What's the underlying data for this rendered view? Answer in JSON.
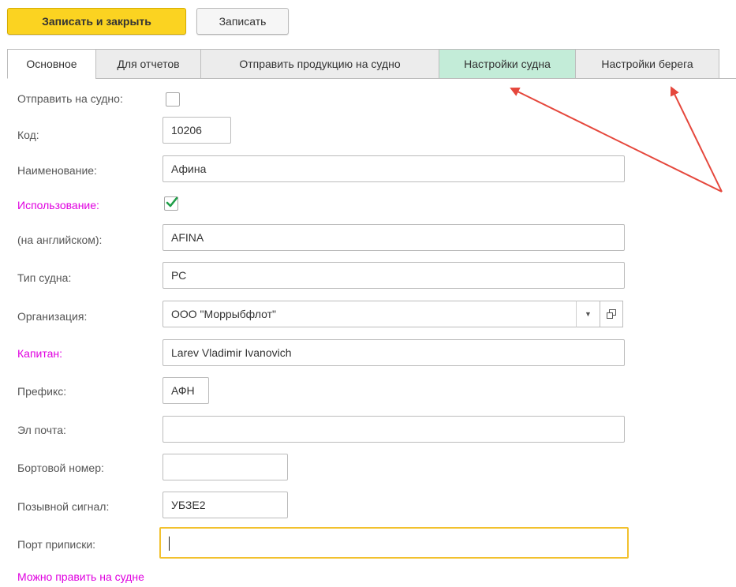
{
  "toolbar": {
    "save_close_label": "Записать и закрыть",
    "save_label": "Записать"
  },
  "tabs": [
    {
      "label": "Основное",
      "active": true
    },
    {
      "label": "Для отчетов"
    },
    {
      "label": "Отправить продукцию на судно"
    },
    {
      "label": "Настройки судна",
      "highlighted": true
    },
    {
      "label": "Настройки берега"
    }
  ],
  "form": {
    "send_to_ship": {
      "label": "Отправить на судно:",
      "checked": false
    },
    "code": {
      "label": "Код:",
      "value": "10206"
    },
    "name": {
      "label": "Наименование:",
      "value": "Афина"
    },
    "usage": {
      "label": "Использование:",
      "checked": true
    },
    "english": {
      "label": "(на английском):",
      "value": "AFINA"
    },
    "ship_type": {
      "label": "Тип судна:",
      "value": "РС"
    },
    "organization": {
      "label": "Организация:",
      "value": "ООО \"Моррыбфлот\""
    },
    "captain": {
      "label": "Капитан:",
      "value": "Larev Vladimir Ivanovich"
    },
    "prefix": {
      "label": "Префикс:",
      "value": "АФН"
    },
    "email": {
      "label": "Эл почта:",
      "value": ""
    },
    "board_number": {
      "label": "Бортовой номер:",
      "value": ""
    },
    "call_sign": {
      "label": "Позывной сигнал:",
      "value": "УБЗЕ2"
    },
    "home_port": {
      "label": "Порт приписки:",
      "value": ""
    },
    "editable_link": "Можно править на судне"
  },
  "colors": {
    "primary_button": "#fbd321",
    "highlight_tab": "#c3ecd8",
    "required_label": "#e000e0",
    "annotation_arrow": "#e5473c",
    "checkmark": "#1f9e48",
    "focus_border": "#f2c12e"
  },
  "icons": {
    "dropdown": "chevron-down-icon",
    "open": "open-window-icon",
    "check": "checkmark-icon"
  }
}
